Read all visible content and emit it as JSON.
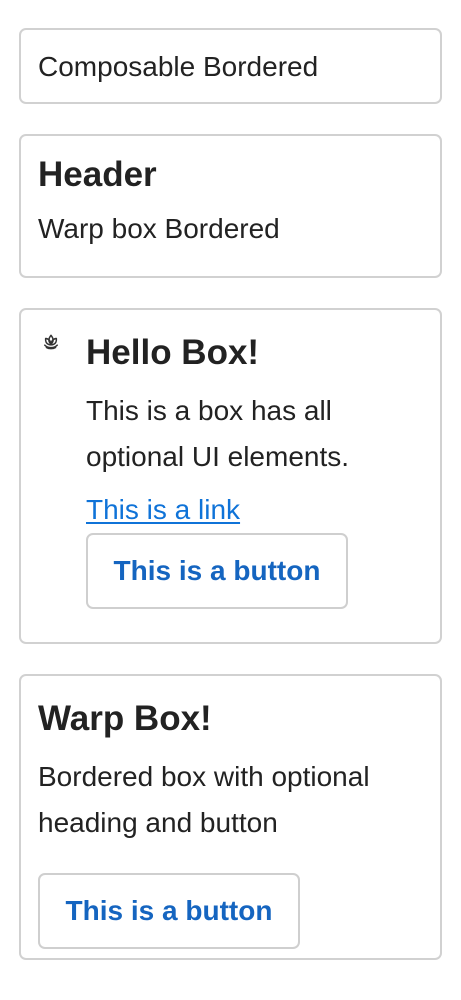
{
  "boxes": [
    {
      "text": "Composable Bordered"
    },
    {
      "header": "Header",
      "text": "Warp box Bordered"
    },
    {
      "icon": "lotus-icon",
      "heading": "Hello Box!",
      "body": "This is a box has all optional UI elements.",
      "link": "This is a link",
      "button": "This is a button"
    },
    {
      "heading": "Warp Box!",
      "body": "Bordered box with optional heading and button",
      "button": "This is a button"
    }
  ],
  "colors": {
    "border": "#d1d1d1",
    "text": "#222222",
    "link": "#0f73d8",
    "button_text": "#1565c0",
    "background": "#ffffff"
  }
}
